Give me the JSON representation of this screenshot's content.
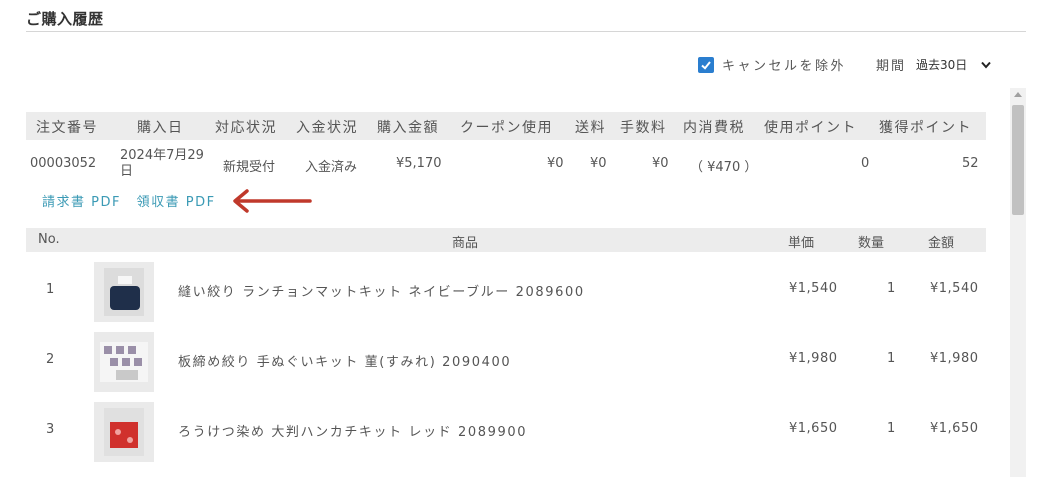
{
  "page": {
    "title": "ご購入履歴"
  },
  "filters": {
    "exclude_cancel_label": "キャンセルを除外",
    "exclude_cancel_checked": true,
    "period_label": "期間",
    "period_value": "過去30日"
  },
  "order_table": {
    "headers": [
      "注文番号",
      "購入日",
      "対応状況",
      "入金状況",
      "購入金額",
      "クーポン使用",
      "送料",
      "手数料",
      "内消費税",
      "使用ポイント",
      "獲得ポイント"
    ],
    "row": {
      "order_no": "00003052",
      "date": "2024年7月29日",
      "status": "新規受付",
      "payment": "入金済み",
      "amount": "¥5,170",
      "coupon": "¥0",
      "shipping": "¥0",
      "fee": "¥0",
      "tax": "（ ¥470 ）",
      "used_points": "0",
      "earned_points": "52"
    }
  },
  "links": {
    "invoice": "請求書 PDF",
    "receipt": "領収書 PDF"
  },
  "items_table": {
    "headers": {
      "no": "No.",
      "product": "商品",
      "unit_price": "単価",
      "qty": "数量",
      "amount": "金額"
    },
    "rows": [
      {
        "no": "1",
        "name": "縫い絞り ランチョンマットキット ネイビーブルー 2089600",
        "price": "¥1,540",
        "qty": "1",
        "amount": "¥1,540"
      },
      {
        "no": "2",
        "name": "板締め絞り 手ぬぐいキット 菫(すみれ) 2090400",
        "price": "¥1,980",
        "qty": "1",
        "amount": "¥1,980"
      },
      {
        "no": "3",
        "name": "ろうけつ染め 大判ハンカチキット レッド 2089900",
        "price": "¥1,650",
        "qty": "1",
        "amount": "¥1,650"
      }
    ]
  },
  "colors": {
    "link": "#3b9ab5",
    "checkbox": "#2a7ecf",
    "arrow": "#c0392b",
    "header_bg": "#ececec"
  }
}
